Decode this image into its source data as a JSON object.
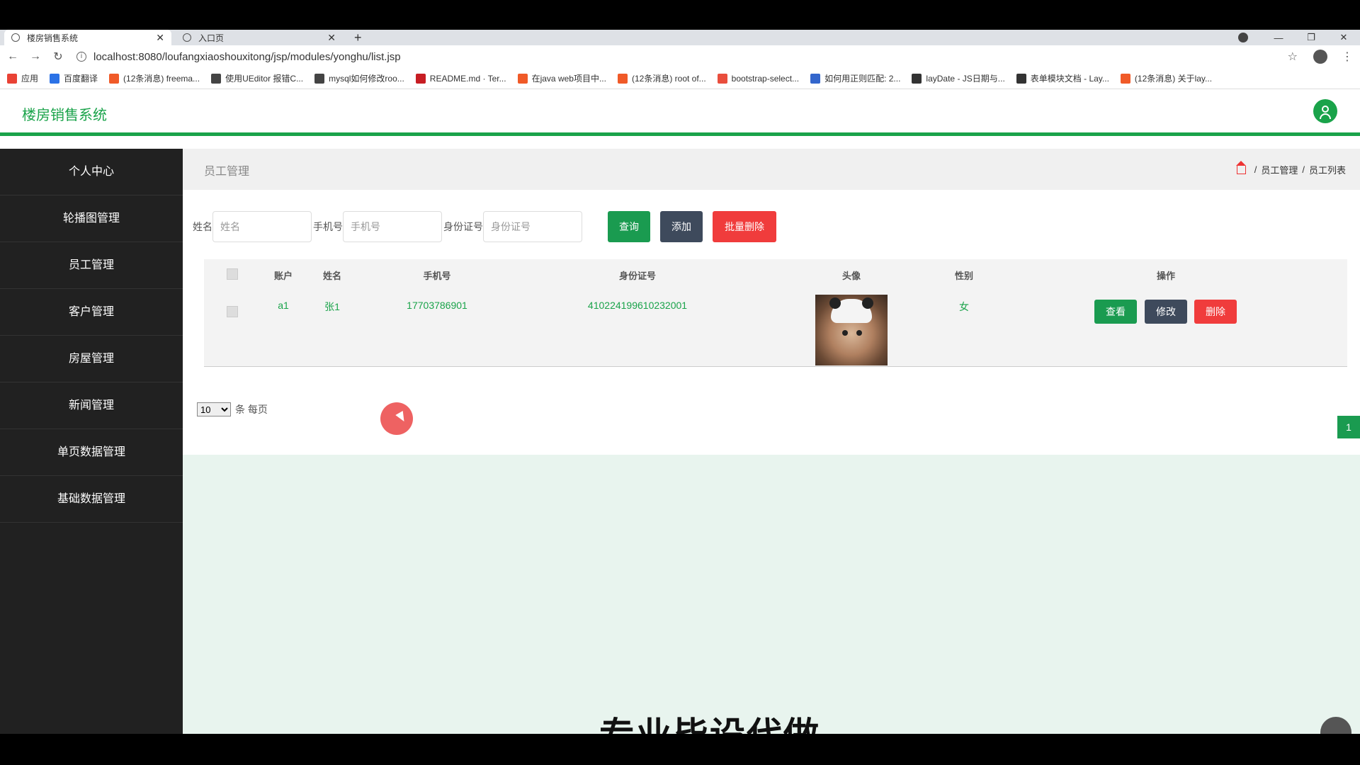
{
  "browser": {
    "tabs": [
      {
        "title": "楼房销售系统",
        "active": true
      },
      {
        "title": "入口页",
        "active": false
      }
    ],
    "url": "localhost:8080/loufangxiaoshouxitong/jsp/modules/yonghu/list.jsp",
    "bookmarks": [
      {
        "label": "应用",
        "color": "#e94235"
      },
      {
        "label": "百度翻译",
        "color": "#2b72e6"
      },
      {
        "label": "(12条消息) freema...",
        "color": "#f05a28"
      },
      {
        "label": "使用UEditor 报错C...",
        "color": "#444444"
      },
      {
        "label": "mysql如何修改roo...",
        "color": "#444444"
      },
      {
        "label": "README.md · Ter...",
        "color": "#c71d23"
      },
      {
        "label": "在java web项目中...",
        "color": "#f05a28"
      },
      {
        "label": "(12条消息) root of...",
        "color": "#f05a28"
      },
      {
        "label": "bootstrap-select...",
        "color": "#e94e3d"
      },
      {
        "label": "如何用正则匹配: 2...",
        "color": "#3366cc"
      },
      {
        "label": "layDate - JS日期与...",
        "color": "#333333"
      },
      {
        "label": "表单模块文档 - Lay...",
        "color": "#333333"
      },
      {
        "label": "(12条消息) 关于lay...",
        "color": "#f05a28"
      }
    ]
  },
  "header": {
    "title": "楼房销售系统",
    "accent": "#1aa34a"
  },
  "sidebar": {
    "items": [
      {
        "label": "个人中心"
      },
      {
        "label": "轮播图管理"
      },
      {
        "label": "员工管理"
      },
      {
        "label": "客户管理"
      },
      {
        "label": "房屋管理"
      },
      {
        "label": "新闻管理"
      },
      {
        "label": "单页数据管理"
      },
      {
        "label": "基础数据管理"
      }
    ]
  },
  "main": {
    "page_title": "员工管理",
    "breadcrumb": [
      "员工管理",
      "员工列表"
    ],
    "search": {
      "name_label": "姓名",
      "name_placeholder": "姓名",
      "phone_label": "手机号",
      "phone_placeholder": "手机号",
      "idcard_label": "身份证号",
      "idcard_placeholder": "身份证号",
      "query_label": "查询",
      "add_label": "添加",
      "batch_delete_label": "批量删除"
    },
    "table": {
      "headers": [
        "账户",
        "姓名",
        "手机号",
        "身份证号",
        "头像",
        "性别",
        "操作"
      ],
      "rows": [
        {
          "account": "a1",
          "name": "张1",
          "phone": "17703786901",
          "idcard": "410224199610232001",
          "gender": "女",
          "actions": {
            "view": "查看",
            "edit": "修改",
            "delete": "删除"
          }
        }
      ]
    },
    "pagination": {
      "page_size": "10",
      "page_size_suffix": "条 每页",
      "current_page": "1"
    },
    "banner_text": "专业毕设代做"
  }
}
